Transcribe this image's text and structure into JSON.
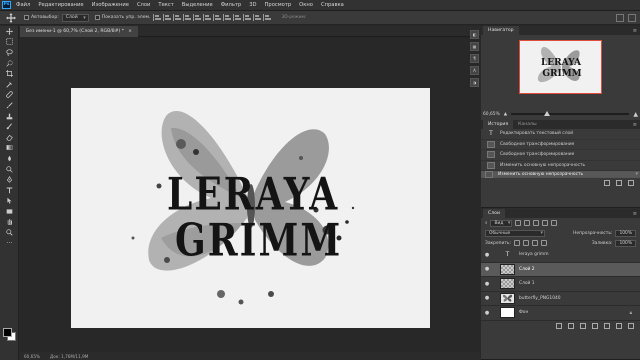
{
  "app": {
    "logo": "Ps"
  },
  "menu": [
    "Файл",
    "Редактирование",
    "Изображение",
    "Слои",
    "Текст",
    "Выделение",
    "Фильтр",
    "3D",
    "Просмотр",
    "Окно",
    "Справка"
  ],
  "options": {
    "autoselect_label": "Автовыбор:",
    "autoselect_value": "Слой",
    "show_controls_label": "Показать упр. элем.",
    "mode_3d_label": "3D-режим:"
  },
  "document": {
    "tab_title": "Без имени-1 @ 60,7% (Слой 2, RGB/8#) *",
    "tab_close": "×",
    "artwork_line1": "LERAYA",
    "artwork_line2": "GRIMM"
  },
  "status": {
    "zoom": "60,65%",
    "doc_size": "Док: 1,76М/11,9М"
  },
  "navigator": {
    "tab": "Навигатор",
    "preview_line1": "LERAYA",
    "preview_line2": "GRIMM",
    "zoom": "60,65%",
    "zoom_level": 0.3
  },
  "history": {
    "tabs": [
      "История",
      "Каналы"
    ],
    "items": [
      {
        "label": "Редактировать текстовый слой",
        "icon": "text"
      },
      {
        "label": "Свободное трансформирование",
        "icon": "doc"
      },
      {
        "label": "Свободное трансформирование",
        "icon": "doc"
      },
      {
        "label": "Изменить основную непрозрачность",
        "icon": "doc"
      },
      {
        "label": "Изменить основную непрозрачность",
        "icon": "doc",
        "selected": true
      }
    ]
  },
  "layers": {
    "tab": "Слои",
    "filter_label": "Вид",
    "blend_mode": "Обычные",
    "opacity_label": "Непрозрачность:",
    "opacity_value": "100%",
    "lock_label": "Закрепить:",
    "fill_label": "Заливка:",
    "fill_value": "100%",
    "items": [
      {
        "name": "leraya grimm",
        "thumb": "text",
        "visible": true
      },
      {
        "name": "Слой 2",
        "thumb": "trans",
        "visible": true,
        "active": true
      },
      {
        "name": "Слой 1",
        "thumb": "trans",
        "visible": true
      },
      {
        "name": "butterfly_PNG1040",
        "thumb": "butterfly",
        "visible": true
      },
      {
        "name": "Фон",
        "thumb": "white",
        "visible": true,
        "locked": true
      }
    ]
  }
}
